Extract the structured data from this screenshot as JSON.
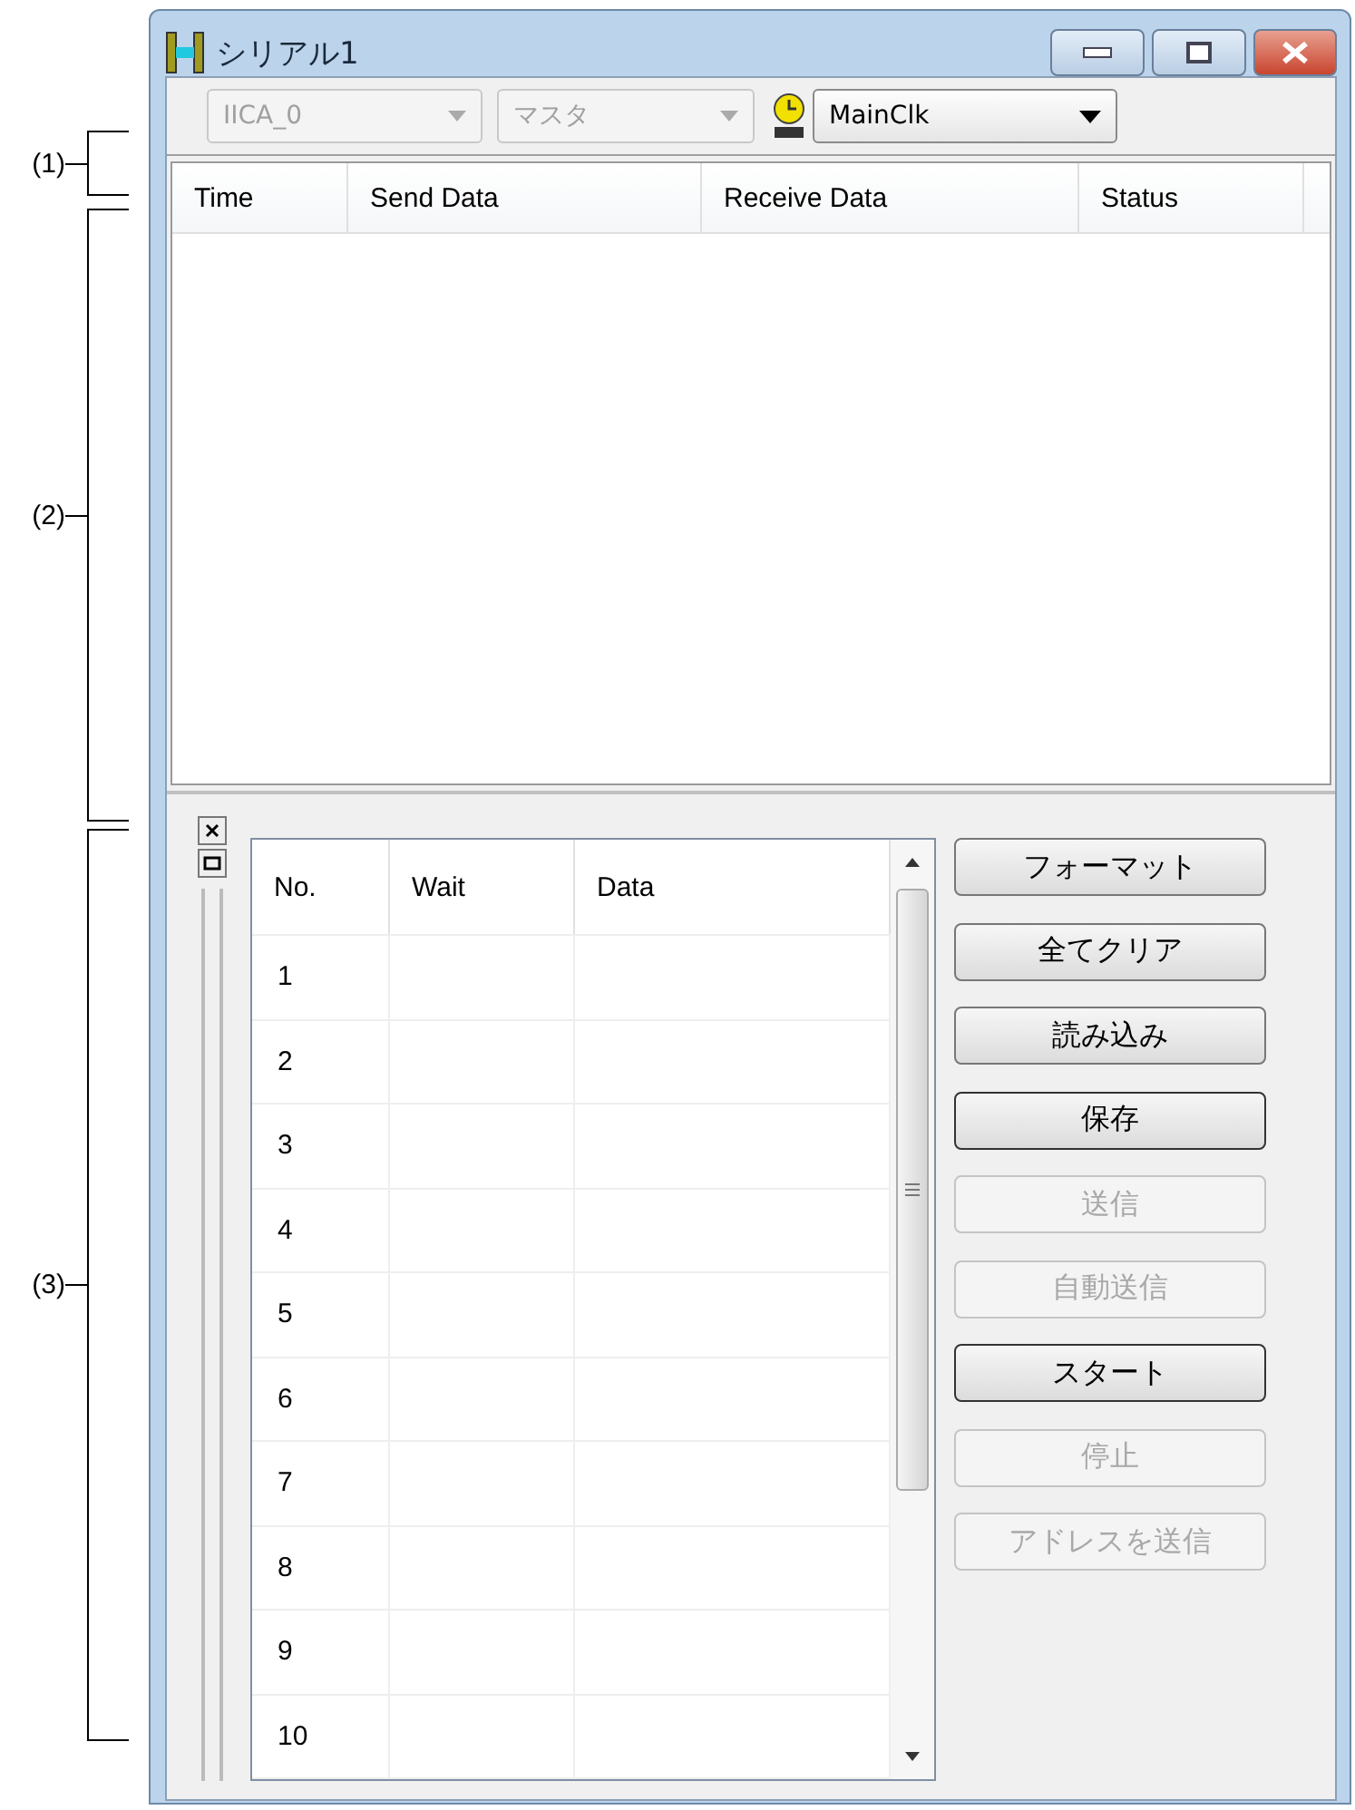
{
  "annotations": [
    {
      "label": "(1)"
    },
    {
      "label": "(2)"
    },
    {
      "label": "(3)"
    }
  ],
  "window": {
    "title": "シリアル1"
  },
  "toolbar": {
    "dropdowns": [
      {
        "value": "IICA_0",
        "disabled": true
      },
      {
        "value": "マスタ",
        "disabled": true
      }
    ],
    "clock": {
      "value": "MainClk",
      "disabled": false
    }
  },
  "log_table": {
    "columns": [
      "Time",
      "Send Data",
      "Receive Data",
      "Status"
    ]
  },
  "send_table": {
    "columns": [
      "No.",
      "Wait",
      "Data"
    ],
    "rows": [
      "1",
      "2",
      "3",
      "4",
      "5",
      "6",
      "7",
      "8",
      "9",
      "10"
    ]
  },
  "buttons": [
    {
      "label": "フォーマット",
      "disabled": false,
      "default": false
    },
    {
      "label": "全てクリア",
      "disabled": false,
      "default": false
    },
    {
      "label": "読み込み",
      "disabled": false,
      "default": false
    },
    {
      "label": "保存",
      "disabled": false,
      "default": true
    },
    {
      "label": "送信",
      "disabled": true,
      "default": false
    },
    {
      "label": "自動送信",
      "disabled": true,
      "default": false
    },
    {
      "label": "スタート",
      "disabled": false,
      "default": true
    },
    {
      "label": "停止",
      "disabled": true,
      "default": false
    },
    {
      "label": "アドレスを送信",
      "disabled": true,
      "default": false
    }
  ]
}
